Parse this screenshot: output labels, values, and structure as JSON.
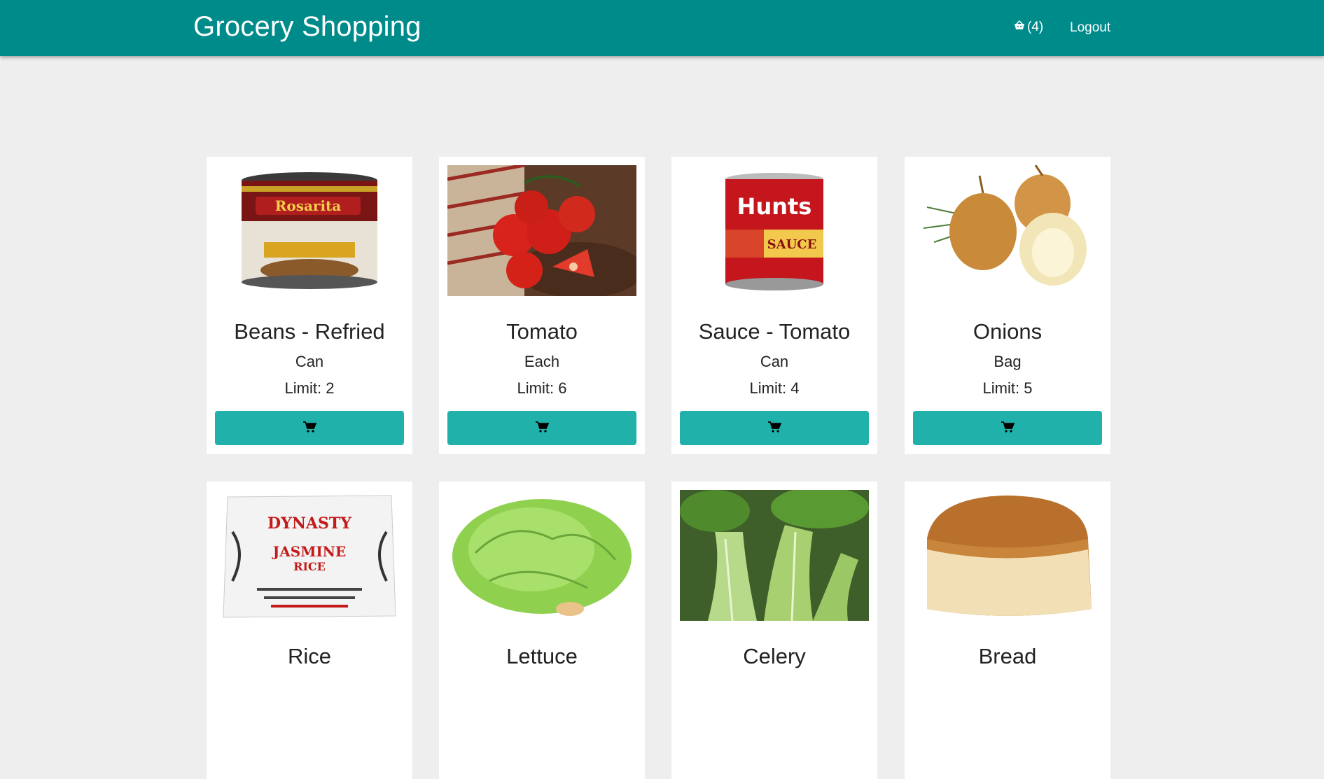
{
  "header": {
    "brand": "Grocery Shopping",
    "cart_count": "(4)",
    "logout_label": "Logout"
  },
  "colors": {
    "navbar": "#008b8b",
    "button": "#20b2aa",
    "page_background": "#eeeeee"
  },
  "products": [
    {
      "name": "Beans - Refried",
      "unit": "Can",
      "limit": "Limit: 2",
      "image_icon": "refried-beans-can-image"
    },
    {
      "name": "Tomato",
      "unit": "Each",
      "limit": "Limit: 6",
      "image_icon": "tomatoes-image"
    },
    {
      "name": "Sauce - Tomato",
      "unit": "Can",
      "limit": "Limit: 4",
      "image_icon": "tomato-sauce-can-image"
    },
    {
      "name": "Onions",
      "unit": "Bag",
      "limit": "Limit: 5",
      "image_icon": "onions-image"
    },
    {
      "name": "Rice",
      "unit": "",
      "limit": "",
      "image_icon": "rice-bag-image"
    },
    {
      "name": "Lettuce",
      "unit": "",
      "limit": "",
      "image_icon": "lettuce-image"
    },
    {
      "name": "Celery",
      "unit": "",
      "limit": "",
      "image_icon": "celery-image"
    },
    {
      "name": "Bread",
      "unit": "",
      "limit": "",
      "image_icon": "bread-image"
    }
  ]
}
